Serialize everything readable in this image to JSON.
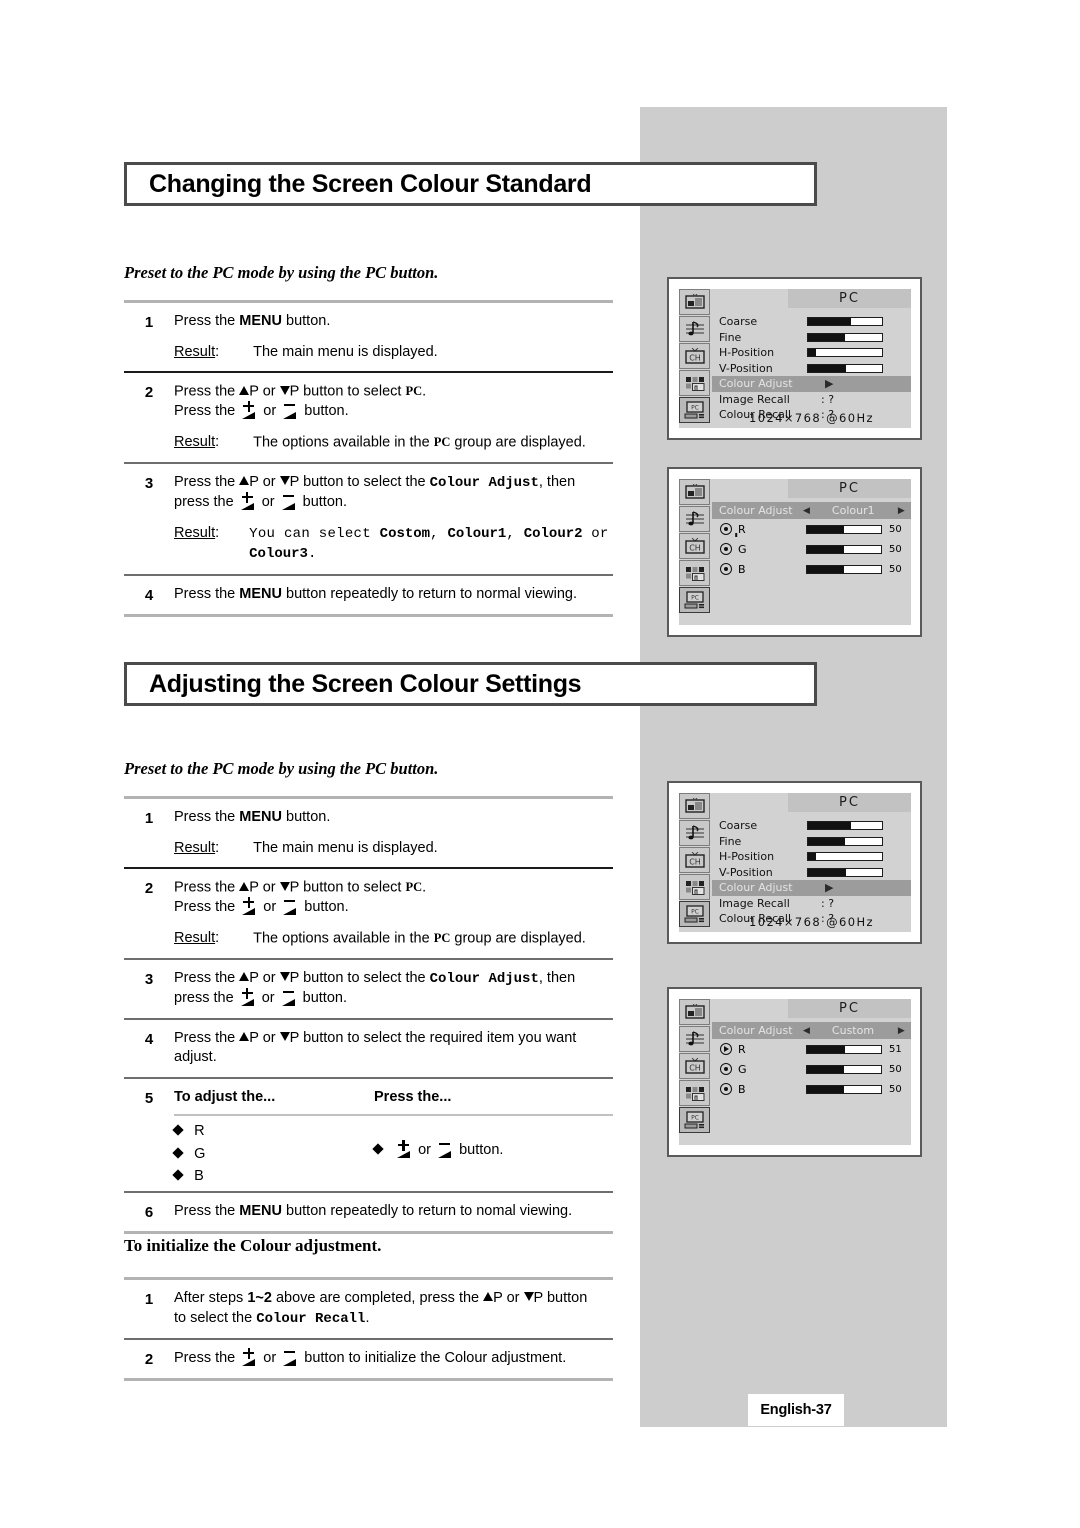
{
  "page": {
    "footer_label": "English-37"
  },
  "sections": [
    {
      "heading": "Changing the Screen Colour Standard",
      "subheading": "Preset to the PC mode by using the PC button.",
      "steps": [
        {
          "num": "1",
          "text_before": "Press the ",
          "bold": "MENU",
          "text_after": " button.",
          "result_label": "Result",
          "result_text": "The main menu is displayed."
        },
        {
          "num": "2",
          "line1_a": "Press the ",
          "line1_p_up": "P or ",
          "line1_p_dn": "P button to select ",
          "line1_target": "PC",
          "line1_end": ".",
          "line2_a": "Press the ",
          "line2_or": " or ",
          "line2_end": " button.",
          "result_label": "Result",
          "result_a": "The options available in the ",
          "result_target": "PC",
          "result_b": " group are displayed."
        },
        {
          "num": "3",
          "line1_a": "Press the ",
          "line1_p_up": "P or ",
          "line1_p_dn": "P button to select the ",
          "line1_menu": "Colour Adjust",
          "line1_end": ", then",
          "line2_a": "press the ",
          "line2_or": " or ",
          "line2_end": " button.",
          "result_label": "Result",
          "result_a": "You can select ",
          "result_opt1": "Costom",
          "result_sep1": ", ",
          "result_opt2": "Colour1",
          "result_sep2": ", ",
          "result_opt3": "Colour2",
          "result_sep3": " or",
          "result_opt4": "Colour3",
          "result_end": "."
        },
        {
          "num": "4",
          "text_before": "Press the ",
          "bold": "MENU",
          "text_after": " button repeatedly to return to normal viewing."
        }
      ]
    },
    {
      "heading": "Adjusting the Screen Colour Settings",
      "subheading": "Preset to the PC mode by using the PC button.",
      "steps": [
        {
          "num": "1",
          "text_before": "Press the ",
          "bold": "MENU",
          "text_after": " button.",
          "result_label": "Result",
          "result_text": "The main menu is displayed."
        },
        {
          "num": "2",
          "line1_a": "Press the ",
          "line1_p_up": "P or ",
          "line1_p_dn": "P button to select ",
          "line1_target": "PC",
          "line1_end": ".",
          "line2_a": "Press the ",
          "line2_or": " or ",
          "line2_end": " button.",
          "result_label": "Result",
          "result_a": "The options available in the ",
          "result_target": "PC",
          "result_b": " group are displayed."
        },
        {
          "num": "3",
          "line1_a": "Press the ",
          "line1_p_up": "P or ",
          "line1_p_dn": "P button to select the ",
          "line1_menu": "Colour Adjust",
          "line1_end": ", then",
          "line2_a": "press the ",
          "line2_or": " or ",
          "line2_end": " button."
        },
        {
          "num": "4",
          "line1_a": "Press the ",
          "line1_p_up": "P or ",
          "line1_p_dn": "P button to select the required item you want",
          "line2": "adjust."
        },
        {
          "num": "5",
          "col1_header": "To adjust the...",
          "col2_header": "Press the...",
          "items": [
            "R",
            "G",
            "B"
          ],
          "action_or": " or ",
          "action_end": " button."
        },
        {
          "num": "6",
          "text_before": "Press the ",
          "bold": "MENU",
          "text_after": " button repeatedly to return to nomal viewing."
        }
      ]
    }
  ],
  "initialize": {
    "heading": "To initialize the Colour adjustment.",
    "steps": [
      {
        "num": "1",
        "a": "After steps ",
        "b_bold": "1~2",
        "c": " above are completed, press the ",
        "p_up": "P or ",
        "p_dn": "P button",
        "line2_a": "to select the ",
        "line2_menu": "Colour Recall",
        "line2_end": "."
      },
      {
        "num": "2",
        "a": "Press the ",
        "or": " or ",
        "end": " button to initialize the Colour adjustment."
      }
    ]
  },
  "osd_screens": [
    {
      "id": "pc-main-1",
      "title": "PC",
      "rows": [
        {
          "label": "Coarse",
          "type": "bar",
          "fill": 58
        },
        {
          "label": "Fine",
          "type": "bar",
          "fill": 50
        },
        {
          "label": "H-Position",
          "type": "bar",
          "fill": 11
        },
        {
          "label": "V-Position",
          "type": "bar",
          "fill": 52
        },
        {
          "label": "Colour Adjust",
          "type": "arrow",
          "highlight": true,
          "value": "▶"
        },
        {
          "label": "Image Recall",
          "type": "text",
          "value": ": ?"
        },
        {
          "label": "Colour Recall",
          "type": "text",
          "value": ": ?"
        }
      ],
      "resolution": "1024×768  @60Hz",
      "icons": [
        "picture-icon",
        "sound-icon",
        "channel-icon",
        "feature-icon",
        "pc-icon"
      ],
      "active_icon_index": 4
    },
    {
      "id": "colour-adjust-colour1",
      "title": "PC",
      "selector": {
        "label": "Colour Adjust",
        "left_arrow": "◀",
        "value": "Colour1",
        "right_arrow": "▶"
      },
      "rgb": [
        {
          "label": "R",
          "fill": 50,
          "value": "50",
          "marker": "dot"
        },
        {
          "label": "G",
          "fill": 50,
          "value": "50",
          "marker": "dot"
        },
        {
          "label": "B",
          "fill": 50,
          "value": "50",
          "marker": "dot"
        }
      ],
      "icons": [
        "picture-icon",
        "sound-icon",
        "channel-icon",
        "feature-icon",
        "pc-icon"
      ],
      "active_icon_index": 4
    },
    {
      "id": "pc-main-2",
      "title": "PC",
      "rows": [
        {
          "label": "Coarse",
          "type": "bar",
          "fill": 58
        },
        {
          "label": "Fine",
          "type": "bar",
          "fill": 50
        },
        {
          "label": "H-Position",
          "type": "bar",
          "fill": 11
        },
        {
          "label": "V-Position",
          "type": "bar",
          "fill": 52
        },
        {
          "label": "Colour Adjust",
          "type": "arrow",
          "highlight": true,
          "value": "▶"
        },
        {
          "label": "Image Recall",
          "type": "text",
          "value": ": ?"
        },
        {
          "label": "Colour Recall",
          "type": "text",
          "value": ": ?"
        }
      ],
      "resolution": "1024×768  @60Hz",
      "icons": [
        "picture-icon",
        "sound-icon",
        "channel-icon",
        "feature-icon",
        "pc-icon"
      ],
      "active_icon_index": 4
    },
    {
      "id": "colour-adjust-custom",
      "title": "PC",
      "selector": {
        "label": "Colour Adjust",
        "left_arrow": "◀",
        "value": "Custom",
        "right_arrow": "▶"
      },
      "rgb": [
        {
          "label": "R",
          "fill": 51,
          "value": "51",
          "marker": "tri"
        },
        {
          "label": "G",
          "fill": 50,
          "value": "50",
          "marker": "dot"
        },
        {
          "label": "B",
          "fill": 50,
          "value": "50",
          "marker": "dot"
        }
      ],
      "icons": [
        "picture-icon",
        "sound-icon",
        "channel-icon",
        "feature-icon",
        "pc-icon"
      ],
      "active_icon_index": 4
    }
  ],
  "colors": {
    "panel_grey": "#cdcdcd",
    "osd_bg": "#d2d2d2",
    "osd_highlight": "#9c9c9c",
    "rule_light": "#b3b3b3",
    "rule_dark": "#1a1a1a"
  }
}
